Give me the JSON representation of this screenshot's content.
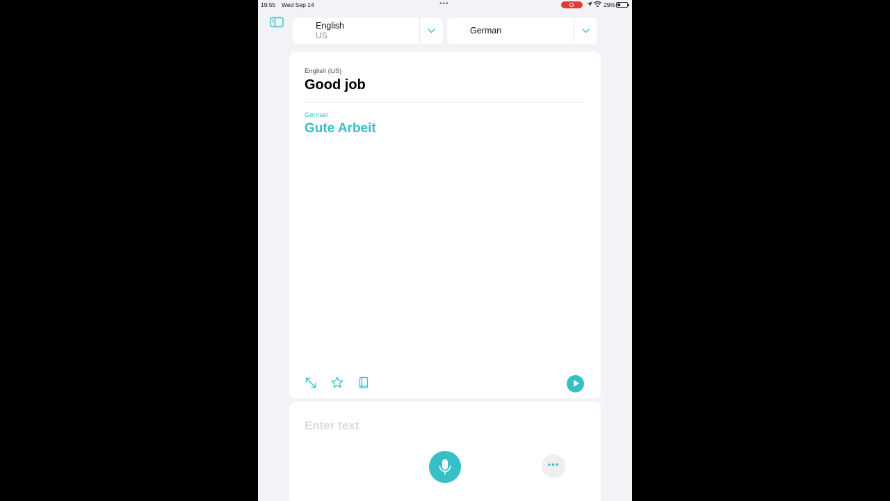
{
  "status_bar": {
    "time": "19:55",
    "date": "Wed Sep 14",
    "battery_percent": "29%",
    "battery_level": 0.29,
    "recording_color": "#e53935"
  },
  "header": {
    "sidebar_icon": "sidebar-icon",
    "source_language": {
      "name": "English",
      "region": "US"
    },
    "target_language": {
      "name": "German"
    },
    "chevron_icon": "chevron-down-icon"
  },
  "translation": {
    "source_label": "English (US)",
    "source_text": "Good job",
    "target_label": "German",
    "target_text": "Gute Arbeit",
    "accent_color": "#37bfc7",
    "actions": [
      "expand-icon",
      "star-icon",
      "book-icon",
      "play-icon"
    ]
  },
  "input": {
    "placeholder": "Enter text",
    "value": "",
    "mic_icon": "microphone-icon",
    "more_icon": "more-icon"
  }
}
